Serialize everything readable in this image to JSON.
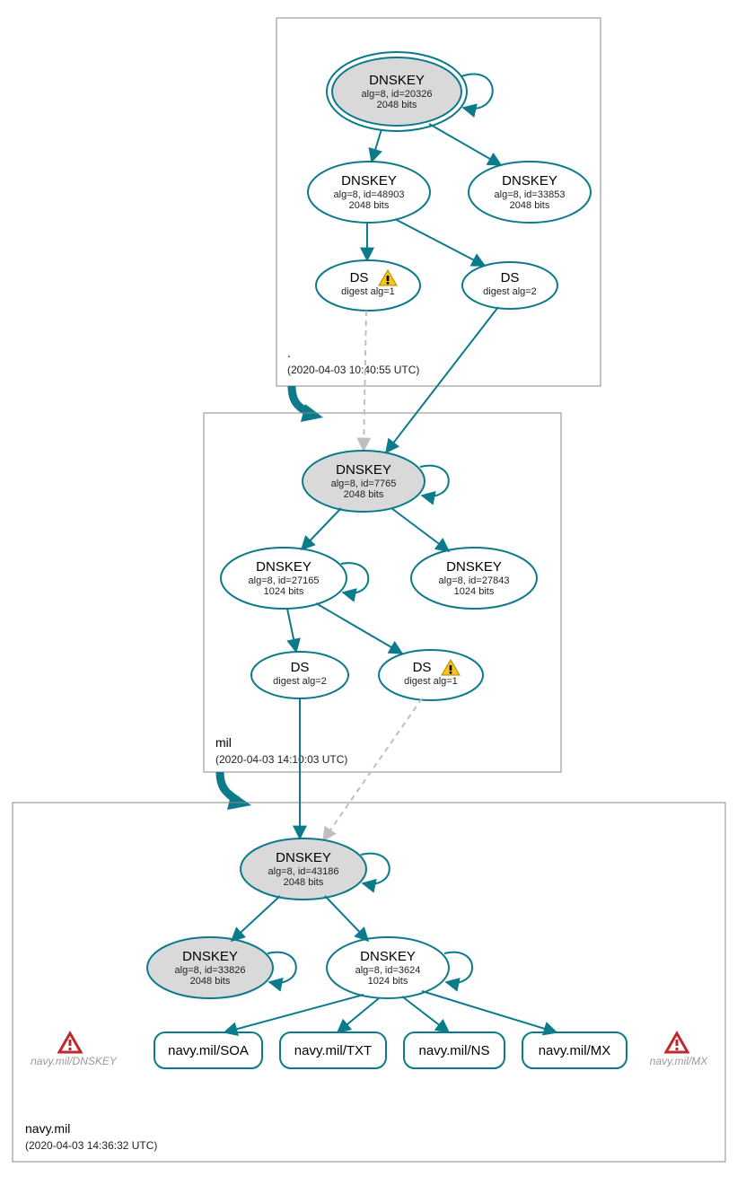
{
  "zones": {
    "root": {
      "label": ".",
      "timestamp": "(2020-04-03 10:40:55 UTC)"
    },
    "mil": {
      "label": "mil",
      "timestamp": "(2020-04-03 14:10:03 UTC)"
    },
    "navy": {
      "label": "navy.mil",
      "timestamp": "(2020-04-03 14:36:32 UTC)"
    }
  },
  "nodes": {
    "root_ksk": {
      "title": "DNSKEY",
      "l1": "alg=8, id=20326",
      "l2": "2048 bits"
    },
    "root_zsk1": {
      "title": "DNSKEY",
      "l1": "alg=8, id=48903",
      "l2": "2048 bits"
    },
    "root_zsk2": {
      "title": "DNSKEY",
      "l1": "alg=8, id=33853",
      "l2": "2048 bits"
    },
    "root_ds1": {
      "title": "DS",
      "l1": "digest alg=1"
    },
    "root_ds2": {
      "title": "DS",
      "l1": "digest alg=2"
    },
    "mil_ksk": {
      "title": "DNSKEY",
      "l1": "alg=8, id=7765",
      "l2": "2048 bits"
    },
    "mil_zsk1": {
      "title": "DNSKEY",
      "l1": "alg=8, id=27165",
      "l2": "1024 bits"
    },
    "mil_zsk2": {
      "title": "DNSKEY",
      "l1": "alg=8, id=27843",
      "l2": "1024 bits"
    },
    "mil_ds1": {
      "title": "DS",
      "l1": "digest alg=2"
    },
    "mil_ds2": {
      "title": "DS",
      "l1": "digest alg=1"
    },
    "navy_ksk": {
      "title": "DNSKEY",
      "l1": "alg=8, id=43186",
      "l2": "2048 bits"
    },
    "navy_zsk1": {
      "title": "DNSKEY",
      "l1": "alg=8, id=33826",
      "l2": "2048 bits"
    },
    "navy_zsk2": {
      "title": "DNSKEY",
      "l1": "alg=8, id=3624",
      "l2": "1024 bits"
    },
    "rr_soa": {
      "title": "navy.mil/SOA"
    },
    "rr_txt": {
      "title": "navy.mil/TXT"
    },
    "rr_ns": {
      "title": "navy.mil/NS"
    },
    "rr_mx": {
      "title": "navy.mil/MX"
    },
    "err_left": {
      "title": "navy.mil/DNSKEY"
    },
    "err_right": {
      "title": "navy.mil/MX"
    }
  }
}
